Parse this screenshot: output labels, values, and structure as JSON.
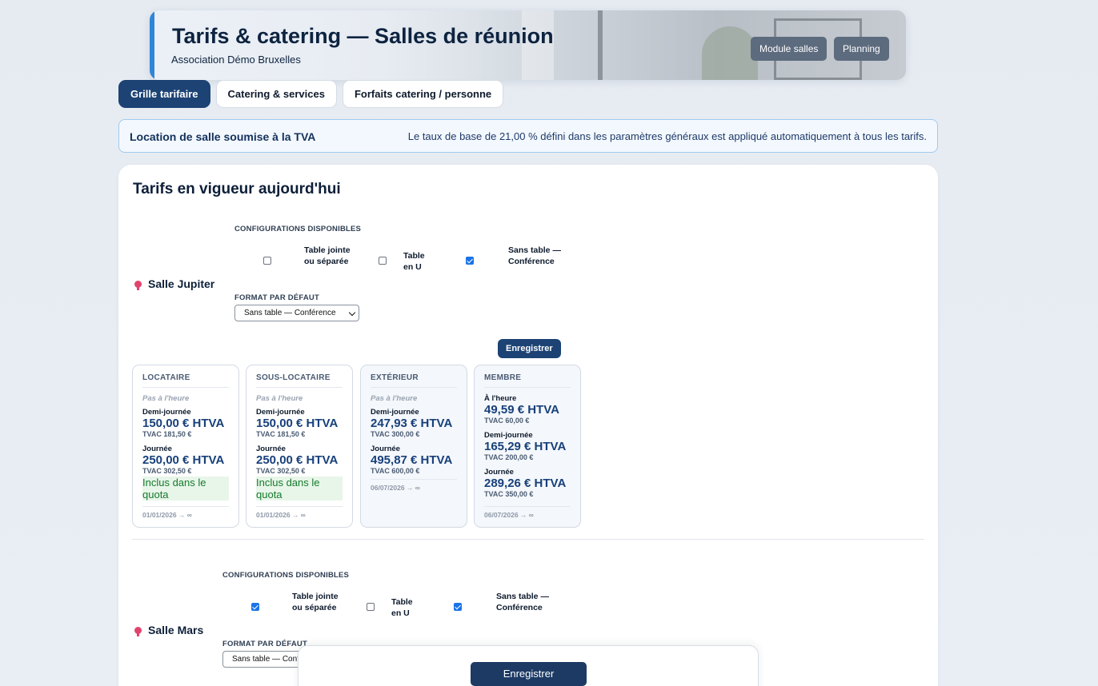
{
  "header": {
    "title": "Tarifs & catering — Salles de réunion",
    "subtitle": "Association Démo Bruxelles",
    "buttons": [
      "Module salles",
      "Planning"
    ]
  },
  "tabs": [
    {
      "label": "Grille tarifaire",
      "active": true
    },
    {
      "label": "Catering & services",
      "active": false
    },
    {
      "label": "Forfaits catering / personne",
      "active": false
    }
  ],
  "vat": {
    "title": "Location de salle soumise à la TVA",
    "text": "Le taux de base de 21,00 % défini dans les paramètres généraux est appliqué automatiquement à tous les tarifs."
  },
  "main": {
    "title": "Tarifs en vigueur aujourd'hui",
    "config_label": "CONFIGURATIONS DISPONIBLES",
    "format_label": "FORMAT PAR DÉFAUT",
    "save_label": "Enregistrer"
  },
  "rooms": [
    {
      "name": "Salle Jupiter",
      "options": [
        {
          "label": "Table jointe ou séparée",
          "checked": false
        },
        {
          "label": "Table en U",
          "checked": false
        },
        {
          "label": "Sans table — Conférence",
          "checked": true
        }
      ],
      "default_format": "Sans table — Conférence",
      "rates": [
        {
          "category": "LOCATAIRE",
          "hour": "Pas à l'heure",
          "half_day_label": "Demi-journée",
          "half_day": "150,00 € HTVA",
          "half_day_tvac": "TVAC 181,50 €",
          "day_label": "Journée",
          "day": "250,00 € HTVA",
          "day_tvac": "TVAC 302,50 €",
          "quota": "Inclus dans le quota",
          "validity": "01/01/2026 → ∞"
        },
        {
          "category": "SOUS-LOCATAIRE",
          "hour": "Pas à l'heure",
          "half_day_label": "Demi-journée",
          "half_day": "150,00 € HTVA",
          "half_day_tvac": "TVAC 181,50 €",
          "day_label": "Journée",
          "day": "250,00 € HTVA",
          "day_tvac": "TVAC 302,50 €",
          "quota": "Inclus dans le quota",
          "validity": "01/01/2026 → ∞"
        },
        {
          "category": "EXTÉRIEUR",
          "hour": "Pas à l'heure",
          "half_day_label": "Demi-journée",
          "half_day": "247,93 € HTVA",
          "half_day_tvac": "TVAC 300,00 €",
          "day_label": "Journée",
          "day": "495,87 € HTVA",
          "day_tvac": "TVAC 600,00 €",
          "validity": "06/07/2026 → ∞"
        },
        {
          "category": "MEMBRE",
          "hour_label": "À l'heure",
          "hour_price": "49,59 € HTVA",
          "hour_tvac": "TVAC 60,00 €",
          "half_day_label": "Demi-journée",
          "half_day": "165,29 € HTVA",
          "half_day_tvac": "TVAC 200,00 €",
          "day_label": "Journée",
          "day": "289,26 € HTVA",
          "day_tvac": "TVAC 350,00 €",
          "validity": "06/07/2026 → ∞"
        }
      ]
    },
    {
      "name": "Salle Mars",
      "options": [
        {
          "label": "Table jointe ou séparée",
          "checked": true
        },
        {
          "label": "Table en U",
          "checked": false
        },
        {
          "label": "Sans table — Conférence",
          "checked": true
        }
      ],
      "default_format": "Sans table — Conférence"
    }
  ],
  "footer": {
    "save_label": "Enregistrer"
  }
}
